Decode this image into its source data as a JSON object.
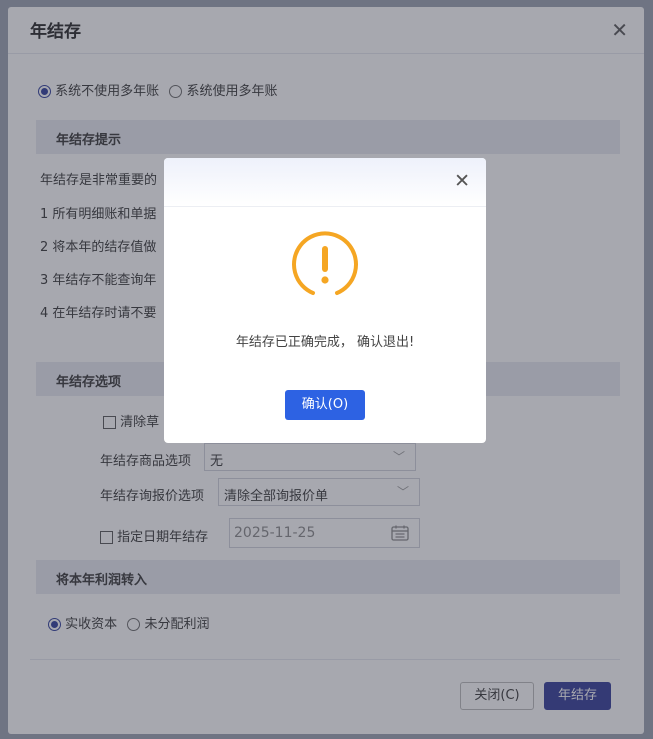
{
  "dialog": {
    "title": "年结存",
    "close_glyph": "✕",
    "radio_options": [
      {
        "label": "系统不使用多年账",
        "selected": true
      },
      {
        "label": "系统使用多年账",
        "selected": false
      }
    ],
    "section_tips": "年结存提示",
    "tips": [
      "年结存是非常重要的",
      "1 所有明细账和单据",
      "2 将本年的结存值做",
      "3 年结存不能查询年",
      "4 在年结存时请不要"
    ],
    "section_options": "年结存选项",
    "clear_draft_label": "清除草",
    "goods_option_label": "年结存商品选项",
    "goods_option_value": "无",
    "quote_option_label": "年结存询报价选项",
    "quote_option_value": "清除全部询报价单",
    "date_check_label": "指定日期年结存",
    "date_value": "2025-11-25",
    "section_profit": "将本年利润转入",
    "profit_options": [
      {
        "label": "实收资本",
        "selected": true
      },
      {
        "label": "未分配利润",
        "selected": false
      }
    ],
    "close_button": "关闭(C)",
    "save_button": "年结存"
  },
  "modal": {
    "close_glyph": "✕",
    "message": "年结存已正确完成， 确认退出!",
    "confirm_button": "确认(O)",
    "icon": "warning-circle-icon",
    "icon_color": "#f5a623",
    "confirm_color": "#2d62e3"
  }
}
